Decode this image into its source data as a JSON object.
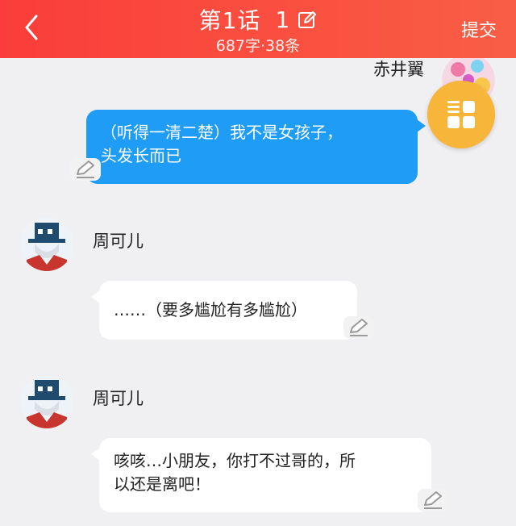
{
  "header": {
    "title": "第1话",
    "title_number": "1",
    "subtitle": "687字·38条",
    "submit_label": "提交",
    "color": "#f9473f"
  },
  "messages": [
    {
      "speaker": "赤井翼",
      "side": "right",
      "text_line1": "（听得一清二楚）我不是女孩子，",
      "text_line2": "头发长而已"
    },
    {
      "speaker": "周可儿",
      "side": "left",
      "text_line1": "……（要多尴尬有多尴尬）"
    },
    {
      "speaker": "周可儿",
      "side": "left",
      "text_line1": "咳咳…小朋友，你打不过哥的，所",
      "text_line2": "以还是离吧！"
    }
  ],
  "colors": {
    "outgoing_bubble": "#1f9cf5",
    "incoming_bubble": "#ffffff",
    "fab": "#f7b53a",
    "background": "#f0f0f2"
  },
  "icons": {
    "back": "chevron-left-icon",
    "edit": "edit-icon",
    "message_edit": "pen-icon",
    "menu": "grid-menu-icon"
  }
}
